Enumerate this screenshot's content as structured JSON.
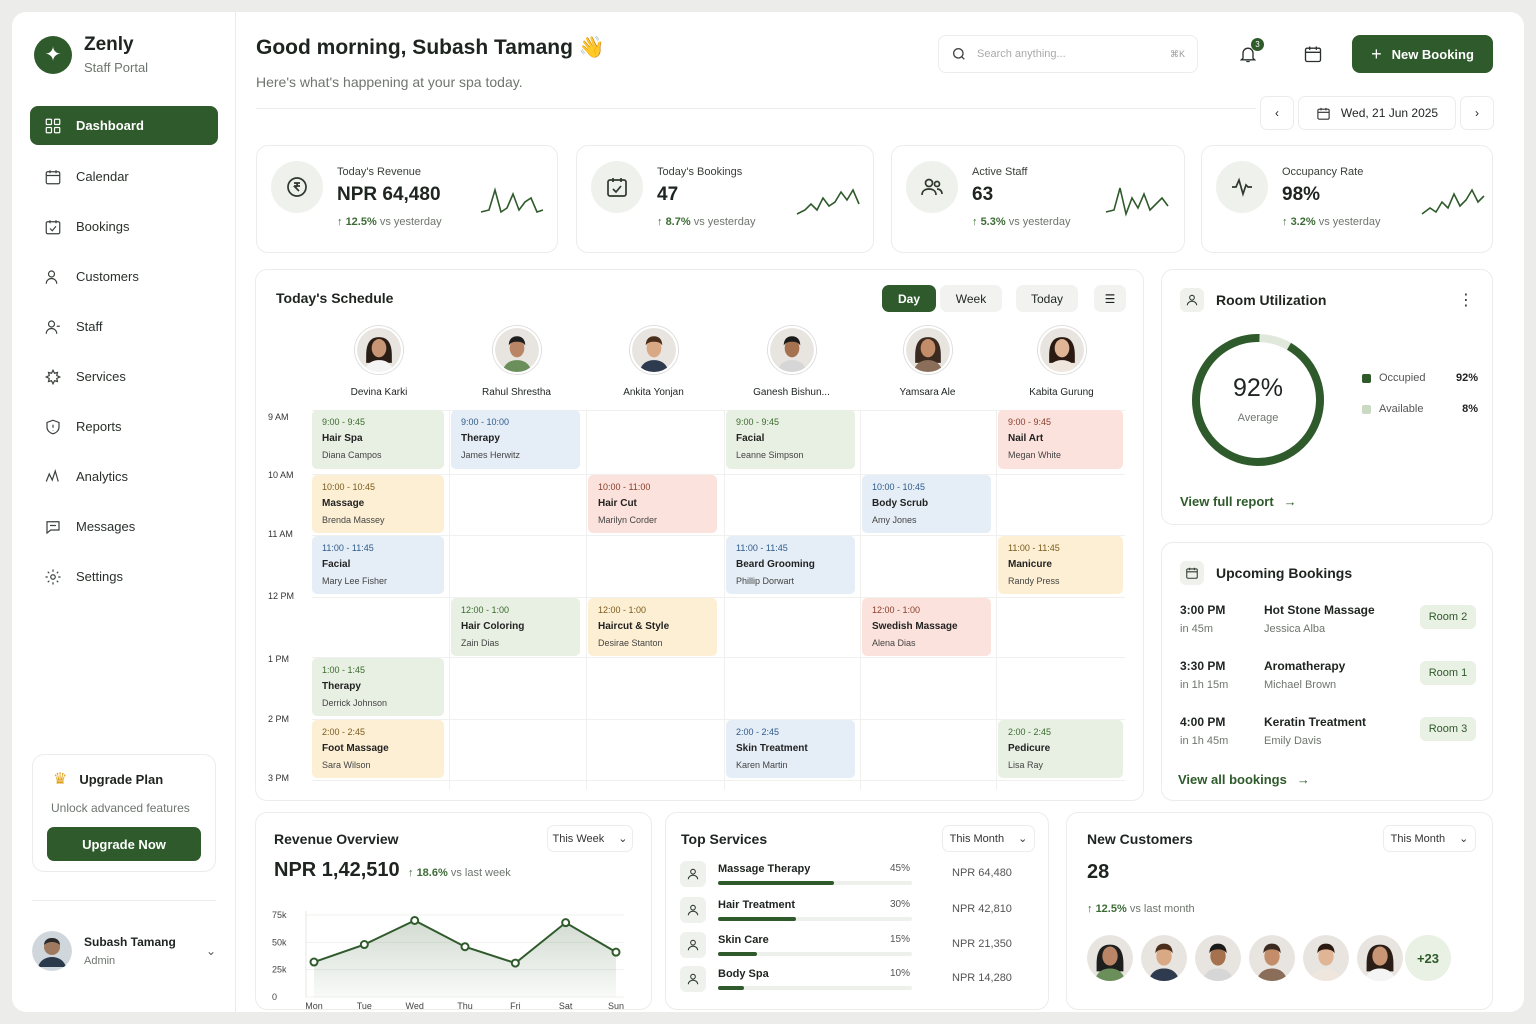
{
  "brand": {
    "name": "Zenly",
    "sub": "Staff Portal"
  },
  "nav": [
    {
      "label": "Dashboard",
      "icon": "dashboard-icon",
      "active": true
    },
    {
      "label": "Calendar",
      "icon": "calendar-icon"
    },
    {
      "label": "Bookings",
      "icon": "bookings-icon"
    },
    {
      "label": "Customers",
      "icon": "customers-icon"
    },
    {
      "label": "Staff",
      "icon": "staff-icon"
    },
    {
      "label": "Services",
      "icon": "services-icon"
    },
    {
      "label": "Reports",
      "icon": "reports-icon"
    },
    {
      "label": "Analytics",
      "icon": "analytics-icon"
    },
    {
      "label": "Messages",
      "icon": "messages-icon"
    },
    {
      "label": "Settings",
      "icon": "settings-icon"
    }
  ],
  "upgrade": {
    "title": "Upgrade Plan",
    "sub": "Unlock advanced features",
    "button": "Upgrade Now"
  },
  "profile": {
    "name": "Subash Tamang",
    "role": "Admin"
  },
  "header": {
    "greeting": "Good morning, Subash Tamang 👋",
    "sub": "Here's what's happening at your spa today.",
    "search_placeholder": "Search anything...",
    "search_kbd": "⌘K",
    "notifications": "3",
    "new_booking": "New Booking",
    "date": "Wed, 21 Jun 2025"
  },
  "stats": [
    {
      "label": "Today's Revenue",
      "value": "NPR 64,480",
      "change": "12.5%",
      "suffix": "vs yesterday",
      "icon": "rupee-icon"
    },
    {
      "label": "Today's Bookings",
      "value": "47",
      "change": "8.7%",
      "suffix": "vs yesterday",
      "icon": "calendar-check-icon"
    },
    {
      "label": "Active Staff",
      "value": "63",
      "change": "5.3%",
      "suffix": "vs yesterday",
      "icon": "users-icon"
    },
    {
      "label": "Occupancy Rate",
      "value": "98%",
      "change": "3.2%",
      "suffix": "vs yesterday",
      "icon": "pulse-icon"
    }
  ],
  "schedule": {
    "title": "Today's Schedule",
    "views": [
      "Day",
      "Week"
    ],
    "today": "Today",
    "staff": [
      "Devina Karki",
      "Rahul Shrestha",
      "Ankita Yonjan",
      "Ganesh Bishun...",
      "Yamsara Ale",
      "Kabita Gurung"
    ],
    "times": [
      "9 AM",
      "10 AM",
      "11 AM",
      "12 PM",
      "1 PM",
      "2 PM",
      "3 PM"
    ],
    "events": [
      {
        "col": 0,
        "row": 0,
        "color": "green",
        "time": "9:00 - 9:45",
        "name": "Hair Spa",
        "client": "Diana Campos"
      },
      {
        "col": 1,
        "row": 0,
        "color": "blue",
        "time": "9:00 - 10:00",
        "name": "Therapy",
        "client": "James Herwitz"
      },
      {
        "col": 3,
        "row": 0,
        "color": "green",
        "time": "9:00 - 9:45",
        "name": "Facial",
        "client": "Leanne Simpson"
      },
      {
        "col": 5,
        "row": 0,
        "color": "pink",
        "time": "9:00 - 9:45",
        "name": "Nail Art",
        "client": "Megan White"
      },
      {
        "col": 0,
        "row": 1,
        "color": "yellow",
        "time": "10:00 - 10:45",
        "name": "Massage",
        "client": "Brenda Massey"
      },
      {
        "col": 2,
        "row": 1,
        "color": "pink",
        "time": "10:00 - 11:00",
        "name": "Hair Cut",
        "client": "Marilyn Corder"
      },
      {
        "col": 4,
        "row": 1,
        "color": "blue",
        "time": "10:00 - 10:45",
        "name": "Body Scrub",
        "client": "Amy Jones"
      },
      {
        "col": 0,
        "row": 2,
        "color": "blue",
        "time": "11:00 - 11:45",
        "name": "Facial",
        "client": "Mary Lee Fisher"
      },
      {
        "col": 3,
        "row": 2,
        "color": "blue",
        "time": "11:00 - 11:45",
        "name": "Beard Grooming",
        "client": "Phillip Dorwart"
      },
      {
        "col": 5,
        "row": 2,
        "color": "yellow",
        "time": "11:00 - 11:45",
        "name": "Manicure",
        "client": "Randy Press"
      },
      {
        "col": 1,
        "row": 3,
        "color": "green",
        "time": "12:00 - 1:00",
        "name": "Hair Coloring",
        "client": "Zain Dias"
      },
      {
        "col": 2,
        "row": 3,
        "color": "yellow",
        "time": "12:00 - 1:00",
        "name": "Haircut & Style",
        "client": "Desirae Stanton"
      },
      {
        "col": 4,
        "row": 3,
        "color": "pink",
        "time": "12:00 - 1:00",
        "name": "Swedish Massage",
        "client": "Alena Dias"
      },
      {
        "col": 0,
        "row": 4,
        "color": "green",
        "time": "1:00 - 1:45",
        "name": "Therapy",
        "client": "Derrick Johnson"
      },
      {
        "col": 0,
        "row": 5,
        "color": "yellow",
        "time": "2:00 - 2:45",
        "name": "Foot Massage",
        "client": "Sara Wilson"
      },
      {
        "col": 3,
        "row": 5,
        "color": "blue",
        "time": "2:00 - 2:45",
        "name": "Skin Treatment",
        "client": "Karen Martin"
      },
      {
        "col": 5,
        "row": 5,
        "color": "green",
        "time": "2:00 - 2:45",
        "name": "Pedicure",
        "client": "Lisa Ray"
      }
    ]
  },
  "room": {
    "title": "Room Utilization",
    "value": "92%",
    "value_sub": "Average",
    "percent": 92,
    "legend": [
      {
        "label": "Occupied",
        "value": "92%",
        "color": "#2f5a2b"
      },
      {
        "label": "Available",
        "value": "8%",
        "color": "#c9d9c2"
      }
    ],
    "link": "View full report"
  },
  "upcoming": {
    "title": "Upcoming Bookings",
    "items": [
      {
        "time": "3:00 PM",
        "in": "in 45m",
        "service": "Hot Stone Massage",
        "customer": "Jessica Alba",
        "room": "Room 2"
      },
      {
        "time": "3:30 PM",
        "in": "in 1h 15m",
        "service": "Aromatherapy",
        "customer": "Michael Brown",
        "room": "Room 1"
      },
      {
        "time": "4:00 PM",
        "in": "in 1h 45m",
        "service": "Keratin Treatment",
        "customer": "Emily Davis",
        "room": "Room 3"
      }
    ],
    "link": "View all bookings"
  },
  "revenue": {
    "title": "Revenue Overview",
    "period": "This Week",
    "total": "NPR 1,42,510",
    "change": "18.6%",
    "suffix": "vs last week"
  },
  "chart_data": {
    "type": "area",
    "categories": [
      "Mon",
      "Tue",
      "Wed",
      "Thu",
      "Fri",
      "Sat",
      "Sun"
    ],
    "values": [
      32000,
      48000,
      70000,
      46000,
      31000,
      68000,
      41000
    ],
    "yticks": [
      "75k",
      "50k",
      "25k",
      "0"
    ],
    "ylim": [
      0,
      75000
    ],
    "color": "#2f5a2b"
  },
  "top_services": {
    "title": "Top Services",
    "period": "This Month",
    "items": [
      {
        "name": "Massage Therapy",
        "pct": "45%",
        "share": 45,
        "amount": "NPR 64,480"
      },
      {
        "name": "Hair Treatment",
        "pct": "30%",
        "share": 30,
        "amount": "NPR 42,810"
      },
      {
        "name": "Skin Care",
        "pct": "15%",
        "share": 15,
        "amount": "NPR 21,350"
      },
      {
        "name": "Body Spa",
        "pct": "10%",
        "share": 10,
        "amount": "NPR 14,280"
      }
    ]
  },
  "new_customers": {
    "title": "New Customers",
    "period": "This Month",
    "count": "28",
    "change": "12.5%",
    "suffix": "vs last month",
    "more": "+23"
  }
}
